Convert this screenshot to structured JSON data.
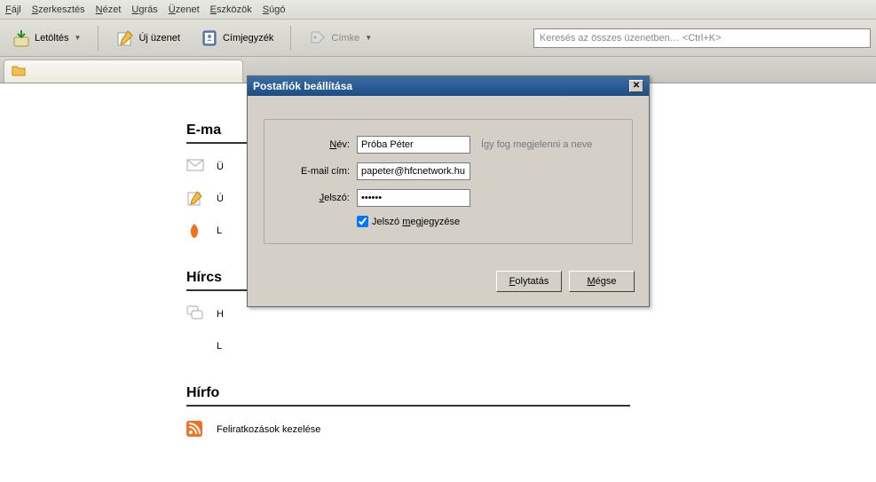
{
  "menu": {
    "file": "Fájl",
    "edit": "Szerkesztés",
    "view": "Nézet",
    "go": "Ugrás",
    "message": "Üzenet",
    "tools": "Eszközök",
    "help": "Súgó"
  },
  "toolbar": {
    "download": "Letöltés",
    "new_message": "Új üzenet",
    "addressbook": "Címjegyzék",
    "tag": "Címke",
    "search_placeholder": "Keresés az összes üzenetben… <Ctrl+K>"
  },
  "tabs": {
    "main": ""
  },
  "main": {
    "section_email": "E-ma",
    "item1": "Ü",
    "item2": "Ú",
    "item3": "L",
    "section_news": "Hírcs",
    "item4": "H",
    "item5": "L",
    "section_feeds": "Hírfo",
    "manage_subs": "Feliratkozások kezelése"
  },
  "dialog": {
    "title": "Postafiók beállítása",
    "name_label": "Név:",
    "name_value": "Próba Péter",
    "name_hint": "Így fog megjelenni a neve",
    "email_label": "E-mail cím:",
    "email_value": "papeter@hfcnetwork.hu",
    "password_label": "Jelszó:",
    "password_value": "••••••",
    "remember_label": "Jelszó megjegyzése",
    "continue": "Folytatás",
    "cancel": "Mégse"
  }
}
